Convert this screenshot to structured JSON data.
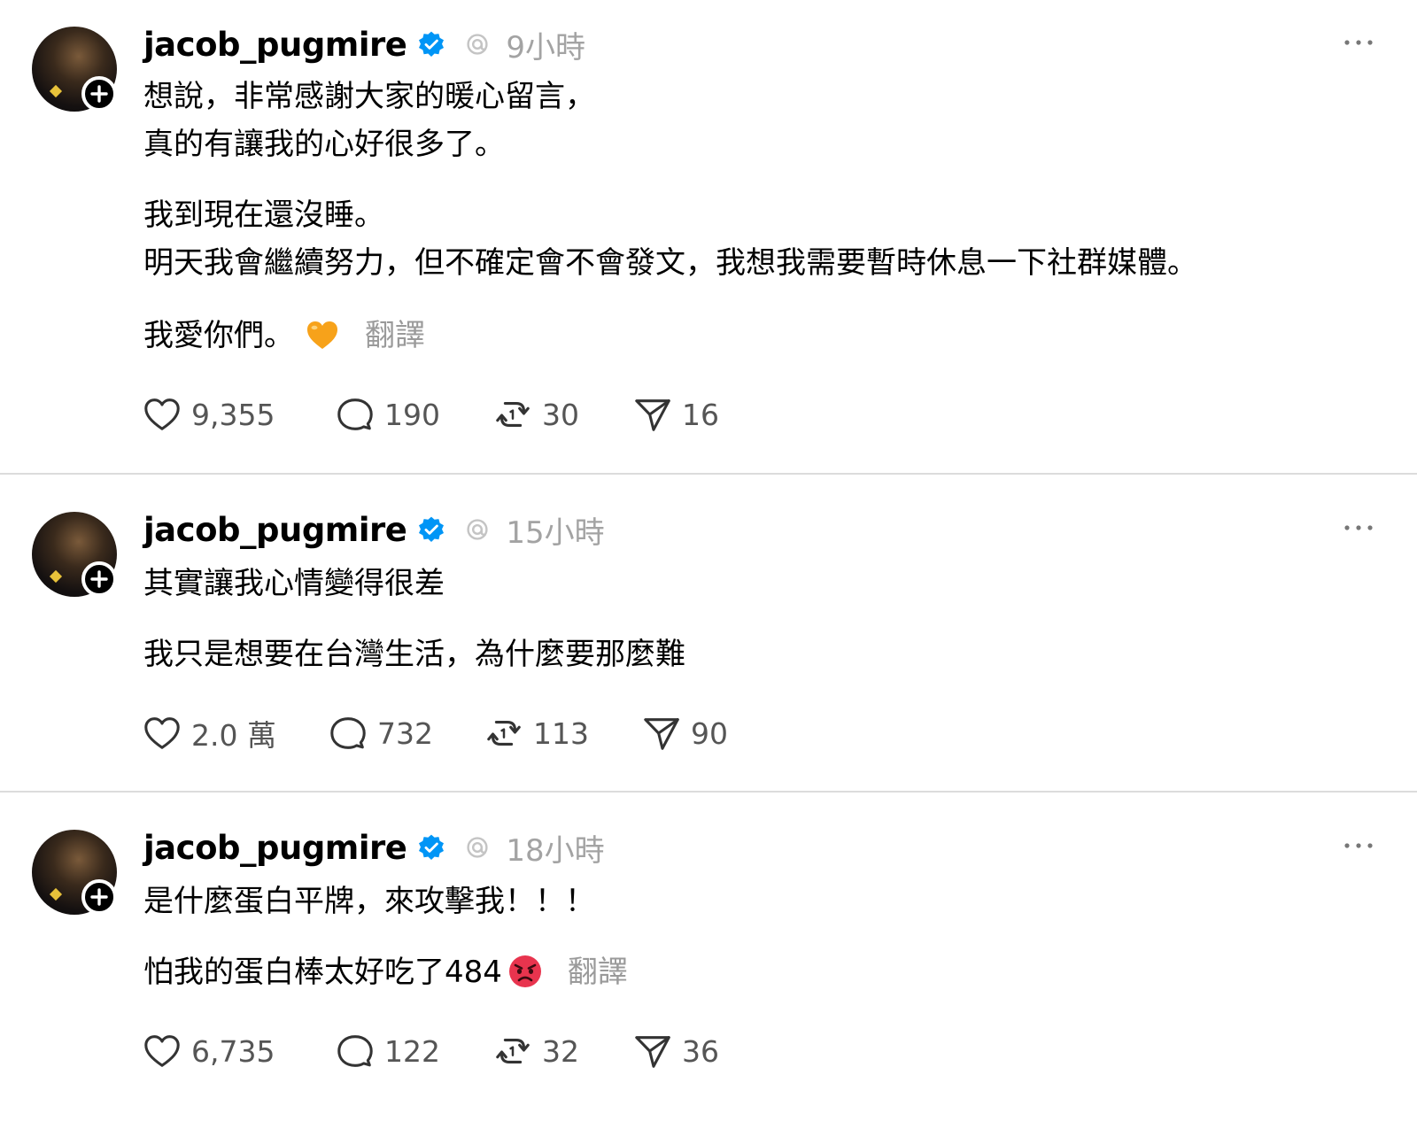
{
  "posts": [
    {
      "username": "jacob_pugmire",
      "time": "9小時",
      "paragraphs": [
        "想說，非常感謝大家的暖心留言，\n真的有讓我的心好很多了。",
        "我到現在還沒睡。\n明天我會繼續努力，但不確定會不會發文，我想我需要暫時休息一下社群媒體。",
        "我愛你們。"
      ],
      "translate": "翻譯",
      "likes": "9,355",
      "comments": "190",
      "reposts": "30",
      "shares": "16"
    },
    {
      "username": "jacob_pugmire",
      "time": "15小時",
      "paragraphs": [
        "其實讓我心情變得很差",
        "我只是想要在台灣生活，為什麼要那麼難"
      ],
      "likes": "2.0 萬",
      "comments": "732",
      "reposts": "113",
      "shares": "90"
    },
    {
      "username": "jacob_pugmire",
      "time": "18小時",
      "paragraphs": [
        "是什麼蛋白平牌，來攻擊我！！！",
        "怕我的蛋白棒太好吃了484"
      ],
      "translate": "翻譯",
      "likes": "6,735",
      "comments": "122",
      "reposts": "32",
      "shares": "36"
    }
  ],
  "icons": {
    "verified": "verified-badge-icon",
    "threads": "threads-logo-icon",
    "more": "more-options-icon",
    "like": "heart-icon",
    "comment": "comment-icon",
    "repost": "repost-icon",
    "share": "send-icon",
    "heart_emoji": "orange-heart-emoji",
    "angry_emoji": "angry-face-emoji"
  },
  "colors": {
    "verified": "#0095f6",
    "muted": "#9a9a9a",
    "divider": "#dcdcdc"
  }
}
